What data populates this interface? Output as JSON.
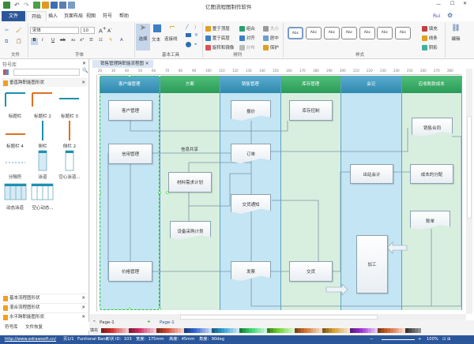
{
  "app": {
    "title": "亿图流程图制作软件",
    "user": "Rui"
  },
  "tabs": [
    "文件",
    "开始",
    "插入",
    "页面布局",
    "视图",
    "符号",
    "帮助"
  ],
  "ribbon": {
    "font_name": "宋体",
    "font_size": "10",
    "groups": [
      "文件",
      "字体",
      "基本工具",
      "排列",
      "样式"
    ],
    "tools": [
      "选择",
      "文本",
      "连接线"
    ],
    "arrange": [
      "置于顶层",
      "置于底层",
      "旋转和镜像",
      "组合",
      "对齐",
      "分布",
      "大小",
      "居中",
      "保护"
    ],
    "style_items": [
      "Abc",
      "Abc",
      "Abc",
      "Abc",
      "Abc",
      "Abc",
      "Abc"
    ],
    "fill": [
      "填充",
      "线条",
      "阴影"
    ],
    "edit": "编辑"
  },
  "library": {
    "title": "符号库",
    "search_placeholder": "",
    "open_lib": "垂直跨职能图形状",
    "shapes": [
      "标题栏",
      "标题栏 2",
      "标题栏 3",
      "标题栏 4",
      "侧栏",
      "侧栏 2",
      "分隔符",
      "泳道",
      "空心泳道...",
      "动态泳道",
      "空心动态..."
    ],
    "other_libs": [
      "基本流程图形状",
      "混合流程图形状",
      "水平跨职能图形状"
    ],
    "bottom_tabs": [
      "符号库",
      "文件恢复"
    ]
  },
  "document": {
    "tab": "销售管理跨职能流程图",
    "ruler": [
      "20",
      "30",
      "40",
      "50",
      "60",
      "70",
      "80",
      "90",
      "100",
      "110",
      "120",
      "130",
      "140",
      "150",
      "160",
      "170",
      "180",
      "190",
      "200",
      "210",
      "220",
      "230",
      "240",
      "250",
      "260",
      "270",
      "280"
    ],
    "lanes": [
      "客户端管理",
      "方案",
      "销售管理",
      "库存管理",
      "会记",
      "应收账款成本"
    ],
    "shapes": {
      "kehu": "客户管理",
      "baojia": "报价",
      "kucun": "库存控制",
      "hetong": "销售合同",
      "xinyong": "信用管理",
      "dingdan": "订单",
      "cailiao": "材料需求计划",
      "jiaohuo_tz": "交货通知",
      "chuzhan": "出站会计",
      "chengben": "成本的分配",
      "shebei": "设备采购计划",
      "zhangdan": "账单",
      "jiagong": "加工",
      "jiage": "价格管理",
      "fapiao": "发票",
      "jiaohuo": "交货"
    },
    "line_label": "信息共享"
  },
  "pages": {
    "current": "Page-1",
    "tab": "Page-1"
  },
  "palette_label": "填充",
  "status": {
    "url": "http://www.edrawsoft.cn/",
    "page": "页1/1",
    "shape": "Funtional Band",
    "id": "形状 ID：103",
    "width": "宽度：175mm",
    "height": "高度：45mm",
    "angle": "角度：90deg",
    "zoom": "100%"
  }
}
